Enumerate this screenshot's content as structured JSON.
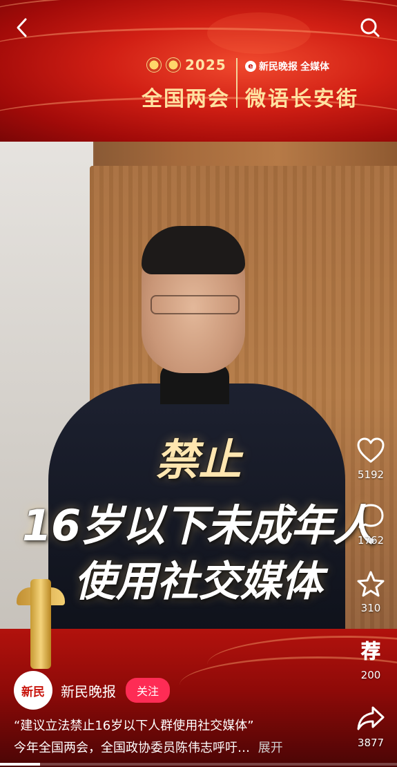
{
  "banner": {
    "year": "2025",
    "left_title": "全国两会",
    "media_brand": "新民晚报",
    "media_suffix": "全媒体",
    "right_title": "微语长安街"
  },
  "video_overlay": {
    "line1": "禁止",
    "line2": "16岁以下未成年人",
    "line3": "使用社交媒体"
  },
  "actions": {
    "likes": "5192",
    "comments": "1762",
    "favorites": "310",
    "recommend": "200",
    "shares": "3877"
  },
  "author": {
    "avatar_text": "新民",
    "name": "新民晚报",
    "follow_label": "关注"
  },
  "post": {
    "title": "“建议立法禁止16岁以下人群使用社交媒体”",
    "description": "今年全国两会，全国政协委员陈伟志呼吁…",
    "expand_label": "展开"
  },
  "progress": 0.1
}
